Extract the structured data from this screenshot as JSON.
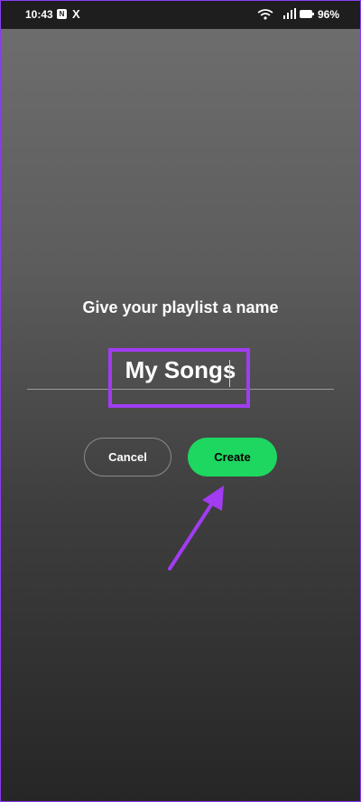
{
  "status_bar": {
    "time": "10:43",
    "notification_badge": "N",
    "x_app": "X",
    "battery_percent": "96%",
    "icons": [
      "n-app-icon",
      "x-app-icon",
      "wifi-icon",
      "signal-icon",
      "battery-icon"
    ]
  },
  "dialog": {
    "heading": "Give your playlist a name",
    "playlist_name_value": "My Songs",
    "cancel_label": "Cancel",
    "create_label": "Create"
  },
  "colors": {
    "accent_green": "#1ed760",
    "annotation_purple": "#a13cf2"
  }
}
